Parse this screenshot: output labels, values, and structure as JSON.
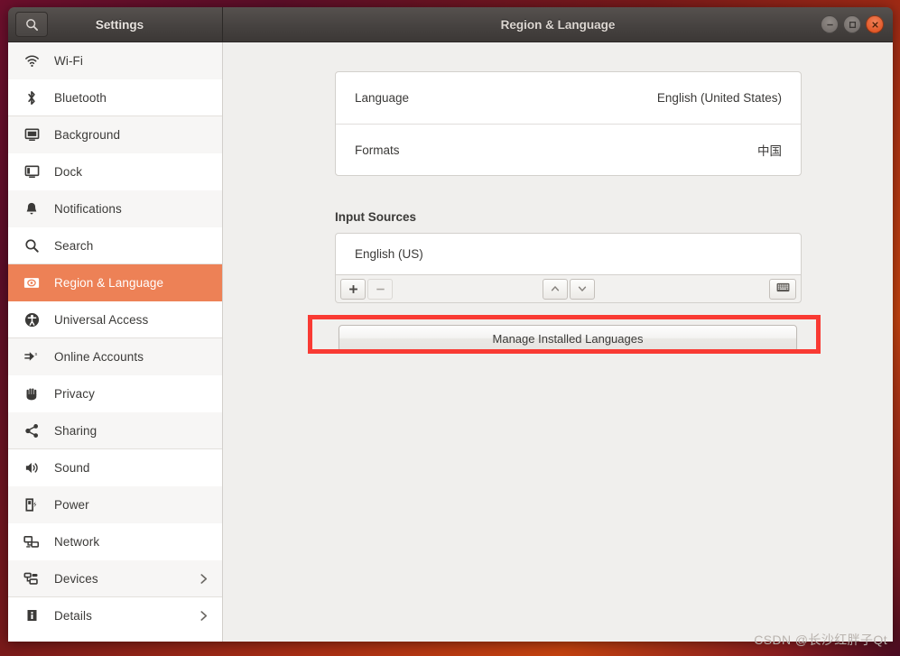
{
  "window": {
    "left_title": "Settings",
    "title": "Region & Language",
    "search_icon": "search-icon",
    "minimize_label": "Minimize",
    "maximize_label": "Maximize",
    "close_label": "Close"
  },
  "sidebar": {
    "items": [
      {
        "label": "Wi-Fi",
        "icon": "wifi-icon",
        "selected": false,
        "chevron": false
      },
      {
        "label": "Bluetooth",
        "icon": "bluetooth-icon",
        "selected": false,
        "chevron": false
      },
      {
        "label": "Background",
        "icon": "background-icon",
        "selected": false,
        "chevron": false
      },
      {
        "label": "Dock",
        "icon": "dock-icon",
        "selected": false,
        "chevron": false
      },
      {
        "label": "Notifications",
        "icon": "bell-icon",
        "selected": false,
        "chevron": false
      },
      {
        "label": "Search",
        "icon": "search-icon",
        "selected": false,
        "chevron": false
      },
      {
        "label": "Region & Language",
        "icon": "region-language-icon",
        "selected": true,
        "chevron": false
      },
      {
        "label": "Universal Access",
        "icon": "accessibility-icon",
        "selected": false,
        "chevron": false
      },
      {
        "label": "Online Accounts",
        "icon": "online-accounts-icon",
        "selected": false,
        "chevron": false
      },
      {
        "label": "Privacy",
        "icon": "hand-icon",
        "selected": false,
        "chevron": false
      },
      {
        "label": "Sharing",
        "icon": "share-icon",
        "selected": false,
        "chevron": false
      },
      {
        "label": "Sound",
        "icon": "speaker-icon",
        "selected": false,
        "chevron": false
      },
      {
        "label": "Power",
        "icon": "power-battery-icon",
        "selected": false,
        "chevron": false
      },
      {
        "label": "Network",
        "icon": "network-icon",
        "selected": false,
        "chevron": false
      },
      {
        "label": "Devices",
        "icon": "devices-icon",
        "selected": false,
        "chevron": true
      },
      {
        "label": "Details",
        "icon": "info-icon",
        "selected": false,
        "chevron": true
      }
    ]
  },
  "main": {
    "language_row": {
      "label": "Language",
      "value": "English (United States)"
    },
    "formats_row": {
      "label": "Formats",
      "value": "中国"
    },
    "input_sources": {
      "heading": "Input Sources",
      "items": [
        {
          "label": "English (US)"
        }
      ],
      "toolbar": {
        "add_label": "+",
        "remove_label": "−",
        "move_up_label": "Move up",
        "move_down_label": "Move down",
        "keyboard_label": "Show keyboard layout"
      }
    },
    "manage_button": "Manage Installed Languages"
  },
  "annotation": {
    "color": "#f93a33"
  },
  "watermark": "CSDN @长沙红胖子Qt"
}
